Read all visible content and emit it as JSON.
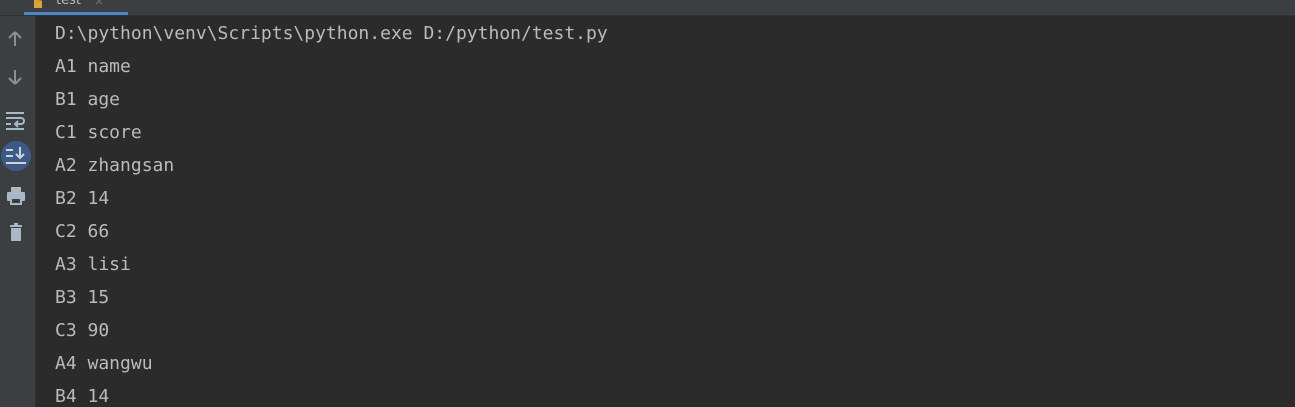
{
  "tab": {
    "label": "test",
    "close": "×",
    "icon": "python-file-icon"
  },
  "toolbar": {
    "items": [
      {
        "name": "up-arrow-icon",
        "label": "Up the stack trace"
      },
      {
        "name": "down-arrow-icon",
        "label": "Down the stack trace"
      },
      {
        "name": "soft-wrap-icon",
        "label": "Soft-wrap"
      },
      {
        "name": "scroll-to-end-icon",
        "label": "Scroll to the end",
        "active": true
      },
      {
        "name": "print-icon",
        "label": "Print"
      },
      {
        "name": "trash-icon",
        "label": "Clear all"
      }
    ]
  },
  "console": {
    "lines": [
      "D:\\python\\venv\\Scripts\\python.exe D:/python/test.py",
      "A1 name",
      "B1 age",
      "C1 score",
      "A2 zhangsan",
      "B2 14",
      "C2 66",
      "A3 lisi",
      "B3 15",
      "C3 90",
      "A4 wangwu",
      "B4 14"
    ]
  },
  "colors": {
    "background": "#2b2b2b",
    "toolbar": "#3c3f41",
    "text": "#bbbbbb",
    "accent": "#4a88c7"
  }
}
